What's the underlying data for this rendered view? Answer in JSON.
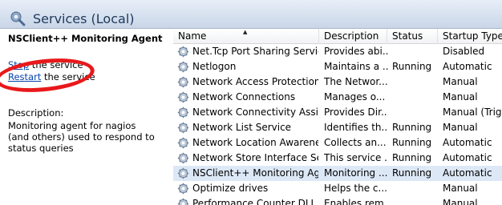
{
  "window": {
    "title": "Services (Local)"
  },
  "detail": {
    "service_name": "NSClient++ Monitoring Agent",
    "stop_link": "Stop",
    "stop_suffix": " the service",
    "restart_link": "Restart",
    "restart_suffix": " the service",
    "description_label": "Description:",
    "description_text": "Monitoring agent for nagios (and others) used to respond to status queries"
  },
  "columns": {
    "name": "Name",
    "description": "Description",
    "status": "Status",
    "startup": "Startup Type"
  },
  "sort_indicator": "▲",
  "rows": [
    {
      "name": "Net.Tcp Port Sharing Service",
      "description": "Provides abi...",
      "status": "",
      "startup": "Disabled"
    },
    {
      "name": "Netlogon",
      "description": "Maintains a ...",
      "status": "Running",
      "startup": "Automatic"
    },
    {
      "name": "Network Access Protection ...",
      "description": "The Networ...",
      "status": "",
      "startup": "Manual"
    },
    {
      "name": "Network Connections",
      "description": "Manages o...",
      "status": "",
      "startup": "Manual"
    },
    {
      "name": "Network Connectivity Assis...",
      "description": "Provides Dir...",
      "status": "",
      "startup": "Manual (Trig..."
    },
    {
      "name": "Network List Service",
      "description": "Identifies th...",
      "status": "Running",
      "startup": "Manual"
    },
    {
      "name": "Network Location Awareness",
      "description": "Collects an...",
      "status": "Running",
      "startup": "Automatic"
    },
    {
      "name": "Network Store Interface Ser...",
      "description": "This service ...",
      "status": "Running",
      "startup": "Automatic"
    },
    {
      "name": "NSClient++ Monitoring Ag...",
      "description": "Monitoring ...",
      "status": "Running",
      "startup": "Automatic",
      "selected": true
    },
    {
      "name": "Optimize drives",
      "description": "Helps the c...",
      "status": "",
      "startup": "Manual"
    },
    {
      "name": "Performance Counter DLL ...",
      "description": "Enables rem...",
      "status": "",
      "startup": "Manual"
    }
  ],
  "icons": {
    "title": "services-gear-icon",
    "row": "service-gear-icon"
  },
  "colors": {
    "highlight_oval": "#e8191b",
    "selected_row": "#dde8f7",
    "link": "#0645ad"
  }
}
